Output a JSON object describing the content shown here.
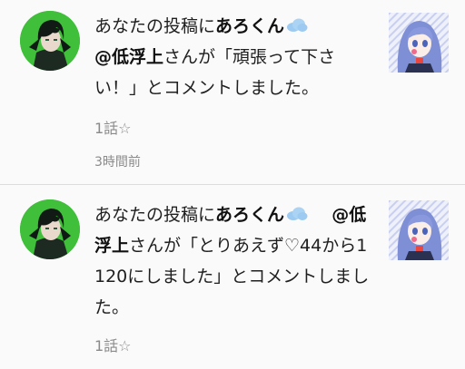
{
  "notifications": [
    {
      "prefix": "あなたの投稿に",
      "user": "あろくん",
      "mention": "@低浮上",
      "body": "さんが「頑張って下さい！」とコメントしました。",
      "story": "1話☆",
      "time": "3時間前"
    },
    {
      "prefix": "あなたの投稿に",
      "user": "あろくん",
      "mention": "@低浮上",
      "body": "さんが「とりあえず♡44から1120にしました」とコメントしました。",
      "story": "1話☆"
    }
  ],
  "icons": {
    "avatar": "user-avatar-anime-boy",
    "thumbnail": "post-thumbnail-anime-girl",
    "badge": "cloud-badge-icon"
  },
  "colors": {
    "avatar_bg": "#3fbf3a",
    "cloud": "#8fc3ef",
    "meta_text": "#8a8a8a"
  }
}
